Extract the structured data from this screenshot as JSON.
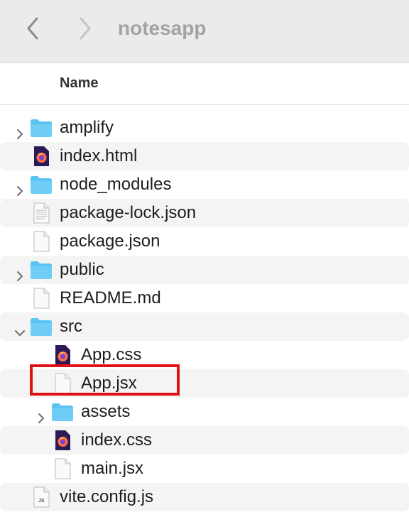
{
  "window": {
    "title": "notesapp"
  },
  "header": {
    "name": "Name"
  },
  "colors": {
    "folder": "#5ac3f2",
    "highlight": "#e01111"
  },
  "files": [
    {
      "name": "amplify",
      "type": "folder",
      "level": 0,
      "expanded": false
    },
    {
      "name": "index.html",
      "type": "firefox-file",
      "level": 0
    },
    {
      "name": "node_modules",
      "type": "folder",
      "level": 0,
      "expanded": false
    },
    {
      "name": "package-lock.json",
      "type": "text-file",
      "level": 0
    },
    {
      "name": "package.json",
      "type": "blank-file",
      "level": 0
    },
    {
      "name": "public",
      "type": "folder",
      "level": 0,
      "expanded": false
    },
    {
      "name": "README.md",
      "type": "blank-file",
      "level": 0
    },
    {
      "name": "src",
      "type": "folder",
      "level": 0,
      "expanded": true
    },
    {
      "name": "App.css",
      "type": "firefox-file",
      "level": 1
    },
    {
      "name": "App.jsx",
      "type": "blank-file",
      "level": 1,
      "highlighted": true
    },
    {
      "name": "assets",
      "type": "folder",
      "level": 1,
      "expanded": false
    },
    {
      "name": "index.css",
      "type": "firefox-file",
      "level": 1
    },
    {
      "name": "main.jsx",
      "type": "blank-file",
      "level": 1
    },
    {
      "name": "vite.config.js",
      "type": "js-file",
      "level": 0,
      "badge": "JS"
    }
  ]
}
